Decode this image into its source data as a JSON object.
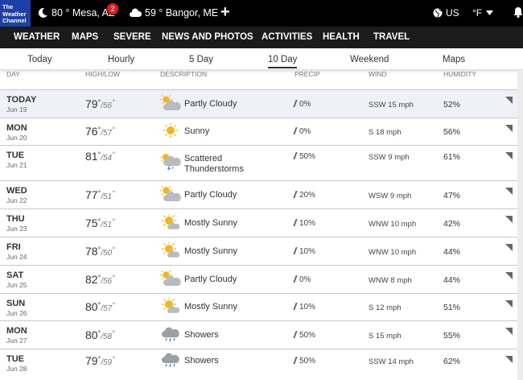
{
  "topbar": {
    "logo_line1": "The",
    "logo_line2": "Weather",
    "logo_line3": "Channel",
    "location1": "80 ° Mesa, AZ",
    "alerts_count": "2",
    "location2": "59 ° Bangor, ME",
    "add_location": "+",
    "region": "US",
    "unit": "°F"
  },
  "nav": [
    "WEATHER",
    "MAPS",
    "SEVERE",
    "NEWS AND PHOTOS",
    "ACTIVITIES",
    "HEALTH",
    "TRAVEL"
  ],
  "tabs": [
    "Today",
    "Hourly",
    "5 Day",
    "10 Day",
    "Weekend",
    "Maps"
  ],
  "active_tab": "10 Day",
  "columns": [
    "DAY",
    "HIGH/LOW",
    "DESCRIPTION",
    "PRECIP",
    "WIND",
    "HUMIDITY"
  ],
  "rows": [
    {
      "day": "TODAY",
      "date": "Jun 19",
      "hi": "79",
      "lo": "56",
      "icon": "partly-cloudy-icon",
      "desc": "Partly Cloudy",
      "precip": "0%",
      "wind": "SSW 15 mph",
      "hum": "52%"
    },
    {
      "day": "MON",
      "date": "Jun 20",
      "hi": "76",
      "lo": "57",
      "icon": "sunny-icon",
      "desc": "Sunny",
      "precip": "0%",
      "wind": "S 18 mph",
      "hum": "56%"
    },
    {
      "day": "TUE",
      "date": "Jun 21",
      "hi": "81",
      "lo": "54",
      "icon": "thunderstorm-icon",
      "desc": "Scattered Thunderstorms",
      "precip": "50%",
      "wind": "SSW 9 mph",
      "hum": "61%"
    },
    {
      "day": "WED",
      "date": "Jun 22",
      "hi": "77",
      "lo": "51",
      "icon": "partly-cloudy-icon",
      "desc": "Partly Cloudy",
      "precip": "20%",
      "wind": "WSW 9 mph",
      "hum": "47%"
    },
    {
      "day": "THU",
      "date": "Jun 23",
      "hi": "75",
      "lo": "51",
      "icon": "mostly-sunny-icon",
      "desc": "Mostly Sunny",
      "precip": "10%",
      "wind": "WNW 10 mph",
      "hum": "42%"
    },
    {
      "day": "FRI",
      "date": "Jun 24",
      "hi": "78",
      "lo": "50",
      "icon": "mostly-sunny-icon",
      "desc": "Mostly Sunny",
      "precip": "10%",
      "wind": "WNW 10 mph",
      "hum": "44%"
    },
    {
      "day": "SAT",
      "date": "Jun 25",
      "hi": "82",
      "lo": "56",
      "icon": "partly-cloudy-icon",
      "desc": "Partly Cloudy",
      "precip": "0%",
      "wind": "WNW 8 mph",
      "hum": "44%"
    },
    {
      "day": "SUN",
      "date": "Jun 26",
      "hi": "80",
      "lo": "57",
      "icon": "mostly-sunny-icon",
      "desc": "Mostly Sunny",
      "precip": "10%",
      "wind": "S 12 mph",
      "hum": "51%"
    },
    {
      "day": "MON",
      "date": "Jun 27",
      "hi": "80",
      "lo": "58",
      "icon": "showers-icon",
      "desc": "Showers",
      "precip": "50%",
      "wind": "S 15 mph",
      "hum": "55%"
    },
    {
      "day": "TUE",
      "date": "Jun 28",
      "hi": "79",
      "lo": "59",
      "icon": "showers-icon",
      "desc": "Showers",
      "precip": "50%",
      "wind": "SSW 14 mph",
      "hum": "62%"
    }
  ],
  "colors": {
    "logo_bg": "#1d3fa8",
    "topbar_bg": "#000000",
    "nav_bg": "#1b1b1b",
    "badge": "#e21c1c",
    "sun": "#f3b71a",
    "cloud": "#b8bcc2"
  }
}
